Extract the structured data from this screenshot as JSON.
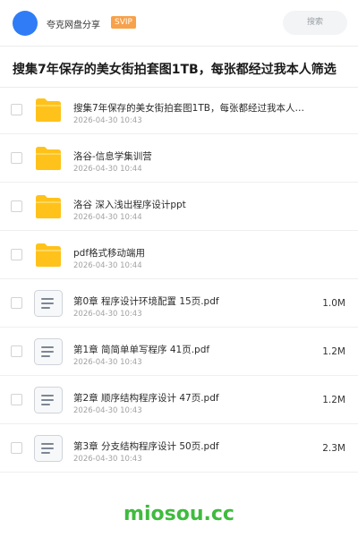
{
  "header": {
    "username": "夸克网盘分享",
    "vip_badge": "SVIP",
    "search_placeholder": "搜索"
  },
  "share_title": "搜集7年保存的美女街拍套图1TB，每张都经过我本人筛选",
  "files": [
    {
      "type": "folder",
      "name": "搜集7年保存的美女街拍套图1TB，每张都经过我本人…",
      "date": "2026-04-30 10:43",
      "size": ""
    },
    {
      "type": "folder",
      "name": "洛谷-信息学集训营",
      "date": "2026-04-30 10:44",
      "size": ""
    },
    {
      "type": "folder",
      "name": "洛谷 深入浅出程序设计ppt",
      "date": "2026-04-30 10:44",
      "size": ""
    },
    {
      "type": "folder",
      "name": "pdf格式移动端用",
      "date": "2026-04-30 10:44",
      "size": ""
    },
    {
      "type": "document",
      "name": "第0章 程序设计环境配置 15页.pdf",
      "date": "2026-04-30 10:43",
      "size": "1.0M"
    },
    {
      "type": "document",
      "name": "第1章 简简单单写程序 41页.pdf",
      "date": "2026-04-30 10:43",
      "size": "1.2M"
    },
    {
      "type": "document",
      "name": "第2章 顺序结构程序设计 47页.pdf",
      "date": "2026-04-30 10:43",
      "size": "1.2M"
    },
    {
      "type": "document",
      "name": "第3章 分支结构程序设计 50页.pdf",
      "date": "2026-04-30 10:43",
      "size": "2.3M"
    }
  ],
  "watermark": "miosou.cc",
  "colors": {
    "avatar": "#2f7cf6",
    "vip": "#f7a14a",
    "folder": "#ffc21a",
    "watermark": "#3fbb3f"
  }
}
